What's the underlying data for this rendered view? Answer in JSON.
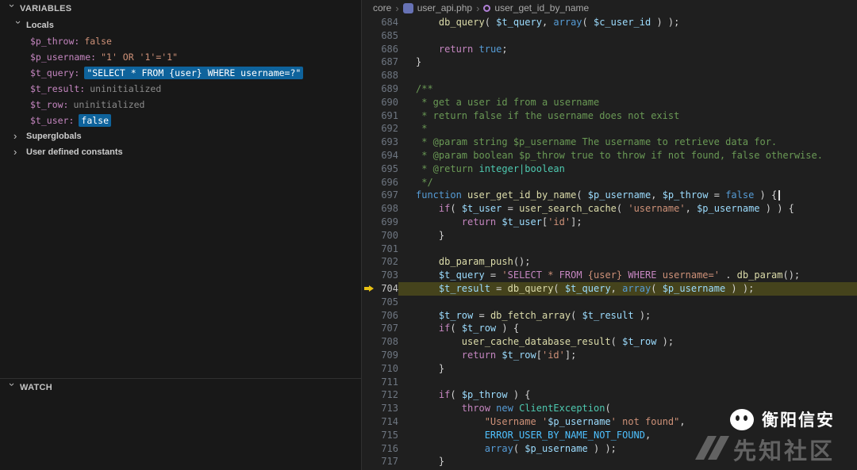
{
  "theme": {
    "editor_background": "#1f1f1f",
    "sidebar_background": "#181818",
    "value_highlight_blue": "#0e639c",
    "current_line_highlight": "#45431c",
    "debug_arrow_yellow": "#e8c113"
  },
  "variables_panel": {
    "title": "VARIABLES",
    "groups": [
      {
        "label": "Locals",
        "expanded": true,
        "items": [
          {
            "name": "$p_throw:",
            "value": "false",
            "vclass": "bool",
            "hl": false
          },
          {
            "name": "$p_username:",
            "value": "\"1' OR '1'='1\"",
            "vclass": "str",
            "hl": false
          },
          {
            "name": "$t_query:",
            "value": "\"SELECT * FROM {user} WHERE username=?\"",
            "vclass": "str",
            "hl": true
          },
          {
            "name": "$t_result:",
            "value": "uninitialized",
            "vclass": "muted",
            "hl": false
          },
          {
            "name": "$t_row:",
            "value": "uninitialized",
            "vclass": "muted",
            "hl": false
          },
          {
            "name": "$t_user:",
            "value": "false",
            "vclass": "bool",
            "hl": true
          }
        ]
      },
      {
        "label": "Superglobals",
        "expanded": false,
        "items": []
      },
      {
        "label": "User defined constants",
        "expanded": false,
        "items": []
      }
    ]
  },
  "watch_panel": {
    "title": "WATCH"
  },
  "breadcrumb": {
    "items": [
      {
        "label": "core",
        "icon": null
      },
      {
        "label": "user_api.php",
        "icon": "php-file-icon"
      },
      {
        "label": "user_get_id_by_name",
        "icon": "method-icon"
      }
    ]
  },
  "editor": {
    "current_line": 704,
    "lines": [
      {
        "n": 684,
        "t": [
          [
            "pl",
            "    "
          ],
          [
            "fn",
            "db_query"
          ],
          [
            "pu",
            "( "
          ],
          [
            "va",
            "$t_query"
          ],
          [
            "pu",
            ", "
          ],
          [
            "kw",
            "array"
          ],
          [
            "pu",
            "( "
          ],
          [
            "va",
            "$c_user_id"
          ],
          [
            "pu",
            " ) );"
          ]
        ]
      },
      {
        "n": 685,
        "t": []
      },
      {
        "n": 686,
        "t": [
          [
            "pl",
            "    "
          ],
          [
            "ct",
            "return"
          ],
          [
            "pl",
            " "
          ],
          [
            "kw",
            "true"
          ],
          [
            "pu",
            ";"
          ]
        ]
      },
      {
        "n": 687,
        "t": [
          [
            "pu",
            "}"
          ]
        ]
      },
      {
        "n": 688,
        "t": []
      },
      {
        "n": 689,
        "t": [
          [
            "cm",
            "/**"
          ]
        ]
      },
      {
        "n": 690,
        "t": [
          [
            "cm",
            " * get a user id from a username"
          ]
        ]
      },
      {
        "n": 691,
        "t": [
          [
            "cm",
            " * return false if the username does not exist"
          ]
        ]
      },
      {
        "n": 692,
        "t": [
          [
            "cm",
            " *"
          ]
        ]
      },
      {
        "n": 693,
        "t": [
          [
            "cm",
            " * @param string $p_username The username to retrieve data for."
          ]
        ]
      },
      {
        "n": 694,
        "t": [
          [
            "cm",
            " * @param boolean $p_throw true to throw if not found, false otherwise."
          ]
        ]
      },
      {
        "n": 695,
        "t": [
          [
            "cm",
            " * @return "
          ],
          [
            "ty",
            "integer|boolean"
          ]
        ]
      },
      {
        "n": 696,
        "t": [
          [
            "cm",
            " */"
          ]
        ]
      },
      {
        "n": 697,
        "t": [
          [
            "kw",
            "function"
          ],
          [
            "pl",
            " "
          ],
          [
            "fn",
            "user_get_id_by_name"
          ],
          [
            "pu",
            "( "
          ],
          [
            "va",
            "$p_username"
          ],
          [
            "pu",
            ", "
          ],
          [
            "va",
            "$p_throw"
          ],
          [
            "pu",
            " = "
          ],
          [
            "kw",
            "false"
          ],
          [
            "pu",
            " ) {"
          ],
          [
            "cur",
            ""
          ]
        ]
      },
      {
        "n": 698,
        "t": [
          [
            "pl",
            "    "
          ],
          [
            "ct",
            "if"
          ],
          [
            "pu",
            "( "
          ],
          [
            "va",
            "$t_user"
          ],
          [
            "pu",
            " = "
          ],
          [
            "fn",
            "user_search_cache"
          ],
          [
            "pu",
            "( "
          ],
          [
            "st",
            "'username'"
          ],
          [
            "pu",
            ", "
          ],
          [
            "va",
            "$p_username"
          ],
          [
            "pu",
            " ) ) {"
          ]
        ]
      },
      {
        "n": 699,
        "t": [
          [
            "pl",
            "        "
          ],
          [
            "ct",
            "return"
          ],
          [
            "pl",
            " "
          ],
          [
            "va",
            "$t_user"
          ],
          [
            "pu",
            "["
          ],
          [
            "st",
            "'id'"
          ],
          [
            "pu",
            "];"
          ]
        ]
      },
      {
        "n": 700,
        "t": [
          [
            "pl",
            "    "
          ],
          [
            "pu",
            "}"
          ]
        ]
      },
      {
        "n": 701,
        "t": []
      },
      {
        "n": 702,
        "t": [
          [
            "pl",
            "    "
          ],
          [
            "fn",
            "db_param_push"
          ],
          [
            "pu",
            "();"
          ]
        ]
      },
      {
        "n": 703,
        "t": [
          [
            "pl",
            "    "
          ],
          [
            "va",
            "$t_query"
          ],
          [
            "pu",
            " = "
          ],
          [
            "st",
            "'"
          ],
          [
            "sq",
            "SELECT"
          ],
          [
            "st",
            " * "
          ],
          [
            "sq",
            "FROM"
          ],
          [
            "st",
            " {user} "
          ],
          [
            "sq",
            "WHERE"
          ],
          [
            "st",
            " username='"
          ],
          [
            "pu",
            " . "
          ],
          [
            "fn",
            "db_param"
          ],
          [
            "pu",
            "();"
          ]
        ]
      },
      {
        "n": 704,
        "t": [
          [
            "pl",
            "    "
          ],
          [
            "va",
            "$t_result"
          ],
          [
            "pu",
            " = "
          ],
          [
            "fn",
            "db_query"
          ],
          [
            "pu",
            "( "
          ],
          [
            "va",
            "$t_query"
          ],
          [
            "pu",
            ", "
          ],
          [
            "kw",
            "array"
          ],
          [
            "pu",
            "( "
          ],
          [
            "va",
            "$p_username"
          ],
          [
            "pu",
            " ) );"
          ]
        ]
      },
      {
        "n": 705,
        "t": []
      },
      {
        "n": 706,
        "t": [
          [
            "pl",
            "    "
          ],
          [
            "va",
            "$t_row"
          ],
          [
            "pu",
            " = "
          ],
          [
            "fn",
            "db_fetch_array"
          ],
          [
            "pu",
            "( "
          ],
          [
            "va",
            "$t_result"
          ],
          [
            "pu",
            " );"
          ]
        ]
      },
      {
        "n": 707,
        "t": [
          [
            "pl",
            "    "
          ],
          [
            "ct",
            "if"
          ],
          [
            "pu",
            "( "
          ],
          [
            "va",
            "$t_row"
          ],
          [
            "pu",
            " ) {"
          ]
        ]
      },
      {
        "n": 708,
        "t": [
          [
            "pl",
            "        "
          ],
          [
            "fn",
            "user_cache_database_result"
          ],
          [
            "pu",
            "( "
          ],
          [
            "va",
            "$t_row"
          ],
          [
            "pu",
            " );"
          ]
        ]
      },
      {
        "n": 709,
        "t": [
          [
            "pl",
            "        "
          ],
          [
            "ct",
            "return"
          ],
          [
            "pl",
            " "
          ],
          [
            "va",
            "$t_row"
          ],
          [
            "pu",
            "["
          ],
          [
            "st",
            "'id'"
          ],
          [
            "pu",
            "];"
          ]
        ]
      },
      {
        "n": 710,
        "t": [
          [
            "pl",
            "    "
          ],
          [
            "pu",
            "}"
          ]
        ]
      },
      {
        "n": 711,
        "t": []
      },
      {
        "n": 712,
        "t": [
          [
            "pl",
            "    "
          ],
          [
            "ct",
            "if"
          ],
          [
            "pu",
            "( "
          ],
          [
            "va",
            "$p_throw"
          ],
          [
            "pu",
            " ) {"
          ]
        ]
      },
      {
        "n": 713,
        "t": [
          [
            "pl",
            "        "
          ],
          [
            "ct",
            "throw"
          ],
          [
            "pl",
            " "
          ],
          [
            "kw",
            "new"
          ],
          [
            "pl",
            " "
          ],
          [
            "cl",
            "ClientException"
          ],
          [
            "pu",
            "("
          ]
        ]
      },
      {
        "n": 714,
        "t": [
          [
            "pl",
            "            "
          ],
          [
            "st",
            "\"Username '"
          ],
          [
            "va",
            "$p_username"
          ],
          [
            "st",
            "' not found\""
          ],
          [
            "pu",
            ","
          ]
        ]
      },
      {
        "n": 715,
        "t": [
          [
            "pl",
            "            "
          ],
          [
            "co",
            "ERROR_USER_BY_NAME_NOT_FOUND"
          ],
          [
            "pu",
            ","
          ]
        ]
      },
      {
        "n": 716,
        "t": [
          [
            "pl",
            "            "
          ],
          [
            "kw",
            "array"
          ],
          [
            "pu",
            "( "
          ],
          [
            "va",
            "$p_username"
          ],
          [
            "pu",
            " ) );"
          ]
        ]
      },
      {
        "n": 717,
        "t": [
          [
            "pl",
            "    "
          ],
          [
            "pu",
            "}"
          ]
        ]
      }
    ]
  },
  "watermark": {
    "brand1": "衡阳信安",
    "brand2": "先知社区"
  }
}
